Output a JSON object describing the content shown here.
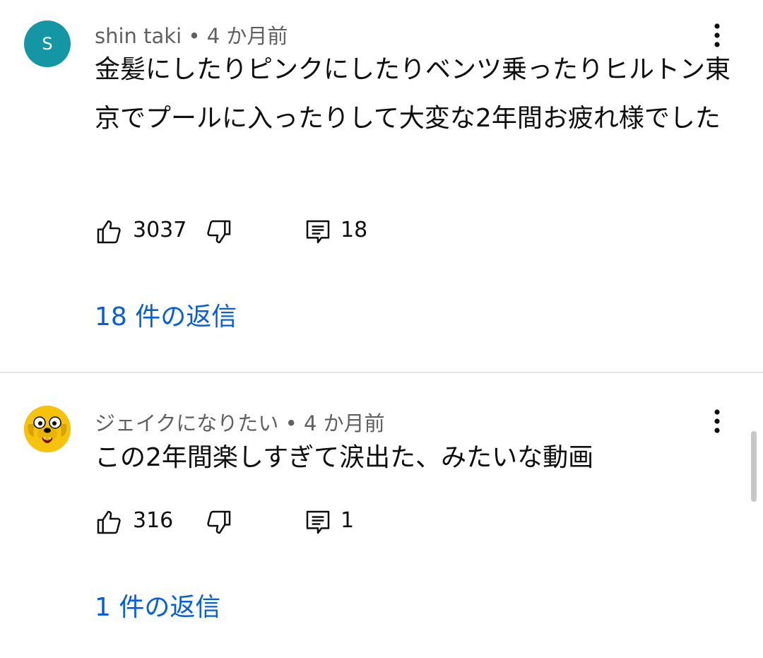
{
  "comments": [
    {
      "avatar_letter": "S",
      "author": "shin taki",
      "separator": "•",
      "time": "4 か月前",
      "text": "金髪にしたりピンクにしたりベンツ乗ったりヒルトン東京でプールに入ったりして大変な2年間お疲れ様でした",
      "likes": "3037",
      "reply_count": "18",
      "replies_label": "18 件の返信"
    },
    {
      "avatar_icon": "jake-the-dog-avatar",
      "author": "ジェイクになりたい",
      "separator": "•",
      "time": "4 か月前",
      "text": "この2年間楽しすぎて涙出た、みたいな動画",
      "likes": "316",
      "reply_count": "1",
      "replies_label": "1 件の返信"
    }
  ],
  "colors": {
    "accent_link": "#065fd4",
    "avatar_s": "#1496a5",
    "avatar_jake": "#f5c20c",
    "secondary_text": "#606060"
  },
  "icons": [
    "thumb-up-icon",
    "thumb-down-icon",
    "reply-icon",
    "more-vert-icon"
  ]
}
